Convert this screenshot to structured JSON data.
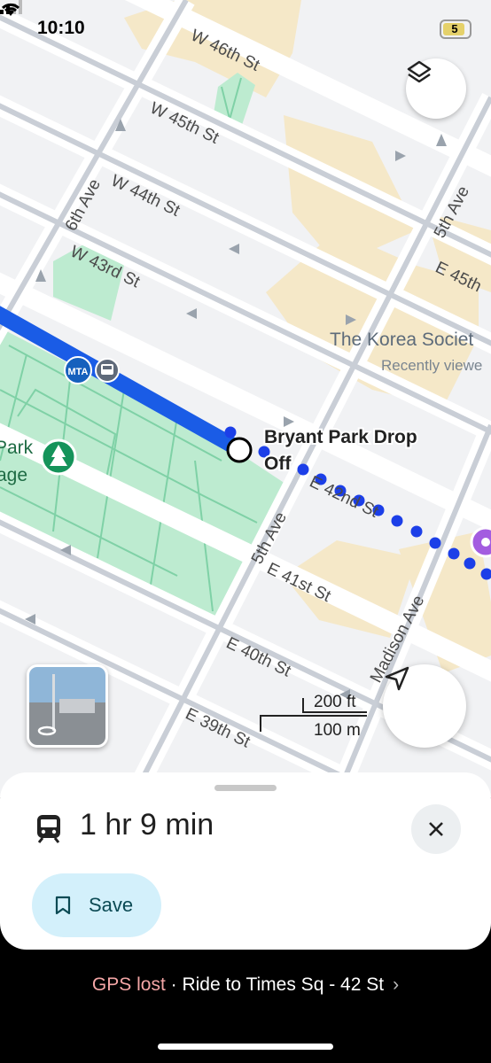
{
  "status_bar": {
    "time": "10:10",
    "battery": "5"
  },
  "map": {
    "streets": {
      "w46": "W 46th St",
      "w45": "W 45th St",
      "w44": "W 44th St",
      "w43": "W 43rd St",
      "e45": "E 45th",
      "e42": "E 42nd St",
      "e41": "E 41st St",
      "e40": "E 40th St",
      "e39": "E 39th St",
      "ave6": "6th Ave",
      "ave5_upper": "5th Ave",
      "ave5_lower": "5th Ave",
      "madison": "Madison Ave"
    },
    "places": {
      "korea_society": "The Korea Societ",
      "korea_society_sub": "Recently viewe",
      "park_label_1": "Park",
      "park_label_2": "age",
      "drop_off_1": "Bryant Park Drop",
      "drop_off_2": "Off"
    },
    "transit_badge": "MTA",
    "scale": {
      "feet": "200 ft",
      "meters": "100 m"
    },
    "route_color": "#1a5ce6",
    "walk_color": "#1c3fe8",
    "park_color": "#bdebd0"
  },
  "sheet": {
    "duration": "1 hr 9 min",
    "save_label": "Save"
  },
  "bottom_bar": {
    "gps_status": "GPS lost",
    "separator": " · ",
    "ride_text": "Ride to Times Sq - 42 St"
  }
}
